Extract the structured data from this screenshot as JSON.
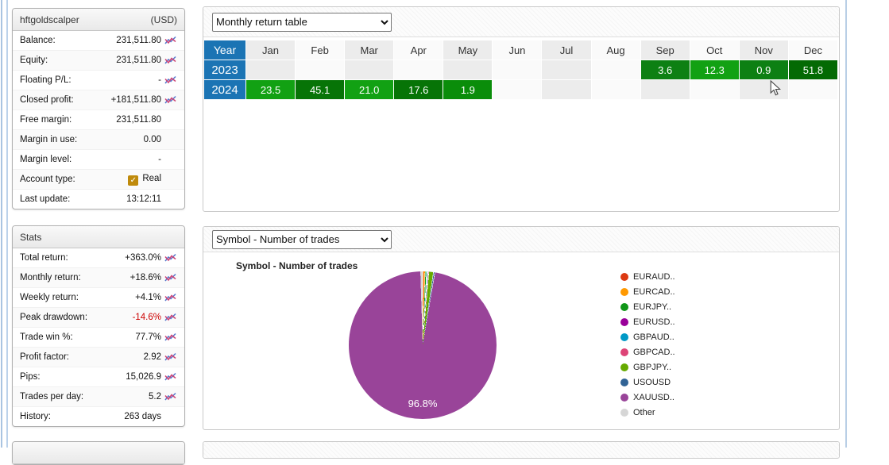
{
  "account_panel": {
    "title": "hftgoldscalper",
    "currency": "(USD)",
    "rows": [
      {
        "label": "Balance:",
        "value": "231,511.80",
        "icon": true,
        "checkbox": false,
        "neg": false
      },
      {
        "label": "Equity:",
        "value": "231,511.80",
        "icon": true,
        "checkbox": false,
        "neg": false
      },
      {
        "label": "Floating P/L:",
        "value": "-",
        "icon": true,
        "checkbox": false,
        "neg": false
      },
      {
        "label": "Closed profit:",
        "value": "+181,511.80",
        "icon": true,
        "checkbox": false,
        "neg": false
      },
      {
        "label": "Free margin:",
        "value": "231,511.80",
        "icon": false,
        "checkbox": false,
        "neg": false
      },
      {
        "label": "Margin in use:",
        "value": "0.00",
        "icon": false,
        "checkbox": false,
        "neg": false
      },
      {
        "label": "Margin level:",
        "value": "-",
        "icon": false,
        "checkbox": false,
        "neg": false
      },
      {
        "label": "Account type:",
        "value": "Real",
        "icon": false,
        "checkbox": true,
        "neg": false
      },
      {
        "label": "Last update:",
        "value": "13:12:11",
        "icon": false,
        "checkbox": false,
        "neg": false
      }
    ]
  },
  "stats_panel": {
    "title": "Stats",
    "rows": [
      {
        "label": "Total return:",
        "value": "+363.0%",
        "icon": true,
        "checkbox": false,
        "neg": false
      },
      {
        "label": "Monthly return:",
        "value": "+18.6%",
        "icon": true,
        "checkbox": false,
        "neg": false
      },
      {
        "label": "Weekly return:",
        "value": "+4.1%",
        "icon": true,
        "checkbox": false,
        "neg": false
      },
      {
        "label": "Peak drawdown:",
        "value": "-14.6%",
        "icon": true,
        "checkbox": false,
        "neg": true
      },
      {
        "label": "Trade win %:",
        "value": "77.7%",
        "icon": true,
        "checkbox": false,
        "neg": false
      },
      {
        "label": "Profit factor:",
        "value": "2.92",
        "icon": true,
        "checkbox": false,
        "neg": false
      },
      {
        "label": "Pips:",
        "value": "15,026.9",
        "icon": true,
        "checkbox": false,
        "neg": false
      },
      {
        "label": "Trades per day:",
        "value": "5.2",
        "icon": true,
        "checkbox": false,
        "neg": false
      },
      {
        "label": "History:",
        "value": "263 days",
        "icon": false,
        "checkbox": false,
        "neg": false
      }
    ]
  },
  "monthly_panel": {
    "dropdown_value": "Monthly return table"
  },
  "symbol_panel": {
    "dropdown_value": "Symbol - Number of trades",
    "chart_title": "Symbol - Number of trades",
    "pie_label": "96.8%"
  },
  "colors": {
    "year_header_bg": "#1b74b4",
    "col_stripe_odd": "#ececec",
    "col_stripe_even": "#fafafa",
    "drawdown_red": "#cc0000",
    "checkbox_gold": "#bf8a0b"
  },
  "chart_data": [
    {
      "type": "table",
      "title": "Monthly return table",
      "columns": [
        "Year",
        "Jan",
        "Feb",
        "Mar",
        "Apr",
        "May",
        "Jun",
        "Jul",
        "Aug",
        "Sep",
        "Oct",
        "Nov",
        "Dec"
      ],
      "rows": [
        {
          "year": "2023",
          "values": [
            null,
            null,
            null,
            null,
            null,
            null,
            null,
            null,
            3.6,
            12.3,
            0.9,
            51.8
          ],
          "cell_colors": [
            null,
            null,
            null,
            null,
            null,
            null,
            null,
            null,
            "#0d8013",
            "#12a113",
            "#0d8013",
            "#046a04"
          ]
        },
        {
          "year": "2024",
          "values": [
            23.5,
            45.1,
            21.0,
            17.6,
            1.9,
            null,
            null,
            null,
            null,
            null,
            null,
            null
          ],
          "cell_colors": [
            "#12a113",
            "#077407",
            "#12a113",
            "#077407",
            "#0a8d0a",
            null,
            null,
            null,
            null,
            null,
            null,
            null
          ]
        }
      ]
    },
    {
      "type": "pie",
      "title": "Symbol - Number of trades",
      "labels": [
        "EURAUD..",
        "EURCAD..",
        "EURJPY..",
        "EURUSD..",
        "GBPAUD..",
        "GBPCAD..",
        "GBPJPY..",
        "USOUSD",
        "XAUUSD..",
        "Other"
      ],
      "values": [
        0.2,
        0.4,
        0.3,
        0.1,
        0.2,
        0.2,
        1.0,
        0.3,
        96.8,
        0.5
      ],
      "colors": [
        "#dc3912",
        "#ff9900",
        "#109618",
        "#990099",
        "#0099c6",
        "#dd4477",
        "#66aa00",
        "#316395",
        "#994499",
        "#d6d6d6"
      ],
      "visible_label": "96.8%",
      "legend_position": "right"
    }
  ]
}
